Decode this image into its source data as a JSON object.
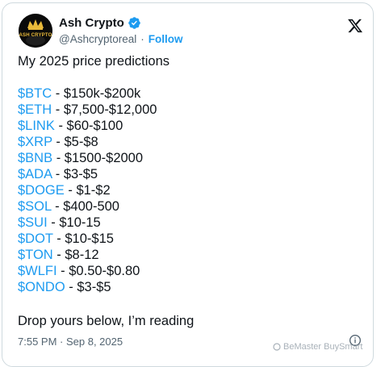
{
  "header": {
    "display_name": "Ash Crypto",
    "handle": "@Ashcryptoreal",
    "separator": "·",
    "follow_label": "Follow",
    "avatar_text": "ASH CRYPTO"
  },
  "tweet": {
    "intro": "My 2025 price predictions",
    "predictions": [
      {
        "ticker": "$BTC",
        "value": " - $150k-$200k"
      },
      {
        "ticker": "$ETH",
        "value": " - $7,500-$12,000"
      },
      {
        "ticker": "$LINK",
        "value": " - $60-$100"
      },
      {
        "ticker": "$XRP",
        "value": " - $5-$8"
      },
      {
        "ticker": "$BNB",
        "value": " - $1500-$2000"
      },
      {
        "ticker": "$ADA",
        "value": " - $3-$5"
      },
      {
        "ticker": "$DOGE",
        "value": " - $1-$2"
      },
      {
        "ticker": "$SOL",
        "value": " - $400-500"
      },
      {
        "ticker": "$SUI",
        "value": " - $10-15"
      },
      {
        "ticker": "$DOT",
        "value": " - $10-$15"
      },
      {
        "ticker": "$TON",
        "value": " - $8-12"
      },
      {
        "ticker": "$WLFI",
        "value": " - $0.50-$0.80"
      },
      {
        "ticker": "$ONDO",
        "value": " - $3-$5"
      }
    ],
    "outro": "Drop yours below, I’m reading",
    "timestamp": "7:55 PM · Sep 8, 2025"
  },
  "watermark": {
    "text": "BeMaster BuySmart"
  },
  "icons": {
    "verified": "verified-badge-icon",
    "platform": "x-logo-icon",
    "info": "info-icon"
  },
  "colors": {
    "link_blue": "#1d9bf0",
    "text_primary": "#0f1419",
    "text_secondary": "#536471",
    "border": "#cfd9de",
    "avatar_gold": "#e8b93a"
  }
}
